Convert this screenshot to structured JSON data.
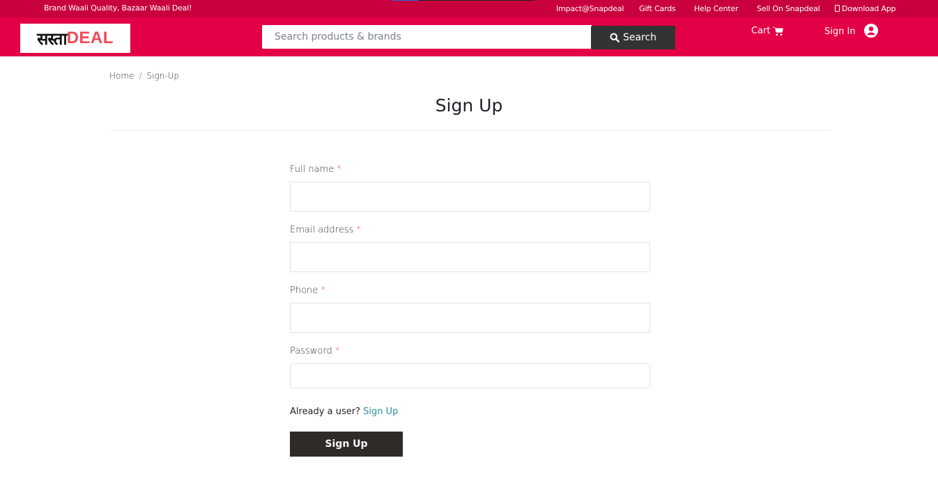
{
  "topbar": {
    "tagline": "Brand Waali Quality, Bazaar Waali Deal!",
    "load_progress": 0.19,
    "links": [
      {
        "label": "Impact@Snapdeal"
      },
      {
        "label": "Gift Cards"
      },
      {
        "label": "Help Center"
      },
      {
        "label": "Sell On Snapdeal"
      },
      {
        "label": "Download App",
        "icon": "mobile-phone-icon"
      }
    ]
  },
  "header": {
    "logo": {
      "hindi": "सस्ता",
      "english": "DEAL"
    },
    "search": {
      "placeholder": "Search products & brands",
      "value": "",
      "button_label": "Search",
      "icon": "search-icon"
    },
    "cart": {
      "label": "Cart",
      "icon": "cart-icon"
    },
    "signin": {
      "label": "Sign In",
      "icon": "user-circle-icon"
    }
  },
  "breadcrumb": [
    {
      "label": "Home"
    },
    {
      "label": "Sign-Up"
    }
  ],
  "breadcrumb_separator": "/",
  "page": {
    "title": "Sign Up"
  },
  "form": {
    "required_marker": "*",
    "fields": [
      {
        "label": "Full name",
        "value": "",
        "type": "text"
      },
      {
        "label": "Email address",
        "value": "",
        "type": "email"
      },
      {
        "label": "Phone",
        "value": "",
        "type": "tel"
      },
      {
        "label": "Password",
        "value": "",
        "type": "password"
      }
    ],
    "already_text": "Already a user?",
    "already_link": "Sign Up",
    "submit_label": "Sign Up"
  },
  "colors": {
    "topbar": "#c8003e",
    "header": "#e40046",
    "search_button": "#333333",
    "submit_button": "#302b27",
    "link": "#2f8f9d",
    "required": "#dc3545",
    "logo_accent": "#f04a55"
  }
}
